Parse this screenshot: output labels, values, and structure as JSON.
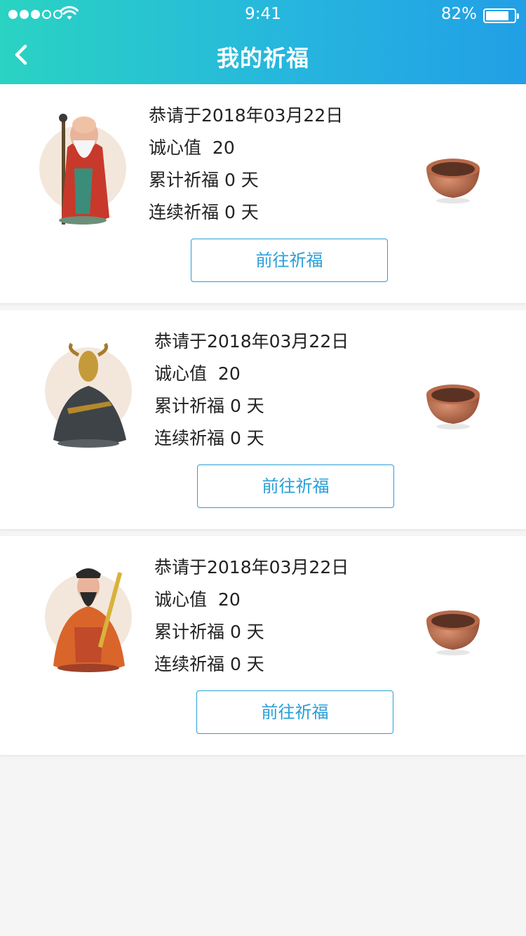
{
  "status_bar": {
    "time": "9:41",
    "battery": "82%"
  },
  "header": {
    "title": "我的祈福"
  },
  "items": [
    {
      "deity_icon": "longevity-god-icon",
      "date_text": "恭请于2018年03月22日",
      "sincerity_label": "诚心值",
      "sincerity_value": "20",
      "total_label": "累计祈福 0 天",
      "streak_label": "连续祈福 0 天",
      "button_label": "前往祈福"
    },
    {
      "deity_icon": "goat-zodiac-icon",
      "date_text": "恭请于2018年03月22日",
      "sincerity_label": "诚心值",
      "sincerity_value": "20",
      "total_label": "累计祈福 0 天",
      "streak_label": "连续祈福 0 天",
      "button_label": "前往祈福"
    },
    {
      "deity_icon": "wealth-god-icon",
      "date_text": "恭请于2018年03月22日",
      "sincerity_label": "诚心值",
      "sincerity_value": "20",
      "total_label": "累计祈福 0 天",
      "streak_label": "连续祈福 0 天",
      "button_label": "前往祈福"
    }
  ],
  "colors": {
    "accent": "#2a9fd8",
    "header_start": "#2ad3c2",
    "header_end": "#229fe6",
    "page_bg": "#f5f5f5"
  }
}
